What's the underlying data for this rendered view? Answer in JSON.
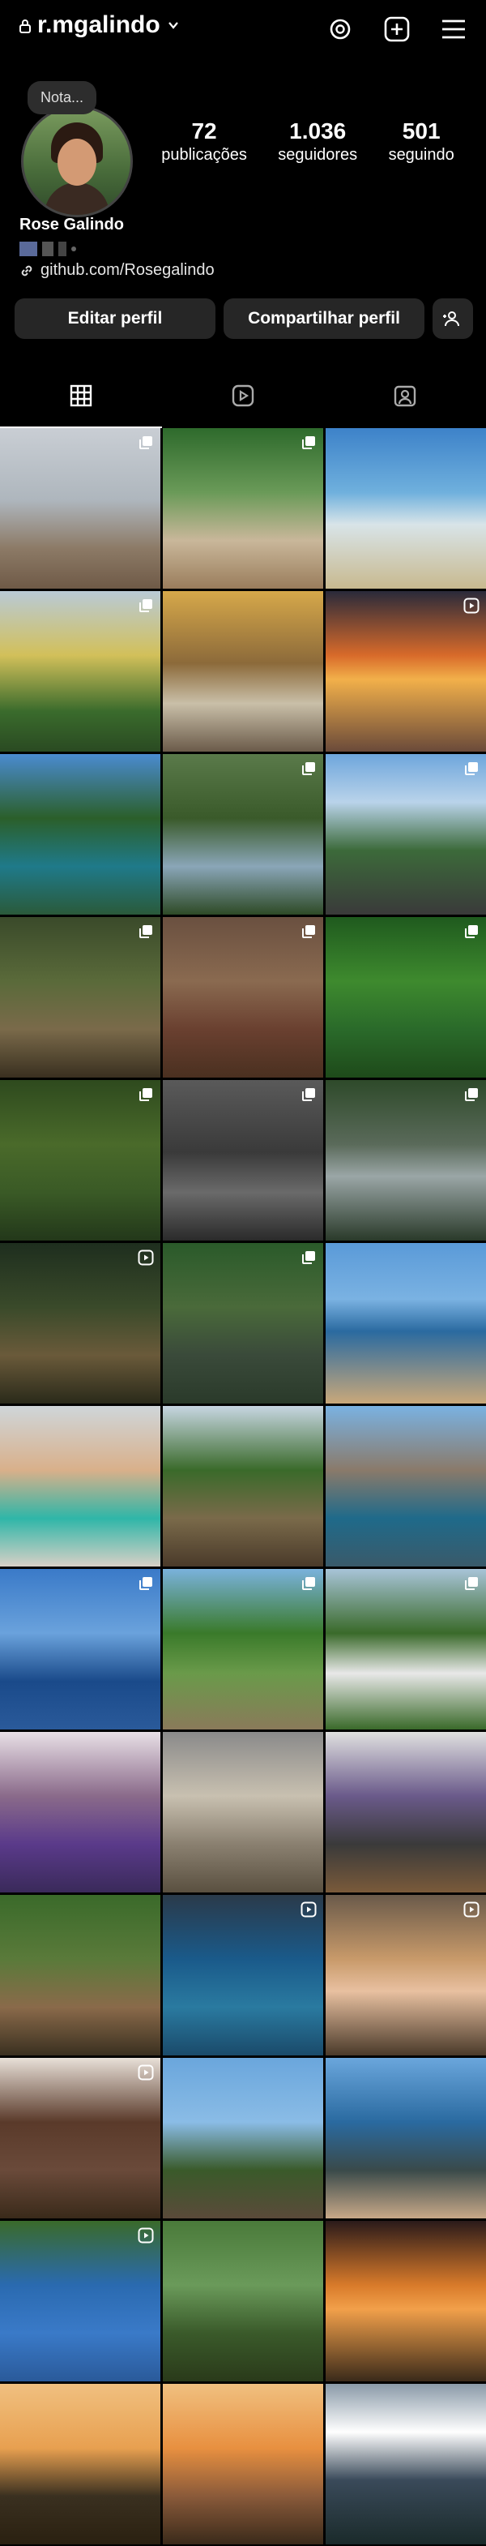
{
  "header": {
    "username": "r.mgalindo"
  },
  "note": {
    "text": "Nota..."
  },
  "profile": {
    "name": "Rose Galindo",
    "link": "github.com/Rosegalindo",
    "stats": [
      {
        "value": "72",
        "label": "publicações"
      },
      {
        "value": "1.036",
        "label": "seguidores"
      },
      {
        "value": "501",
        "label": "seguindo"
      }
    ]
  },
  "buttons": {
    "edit": "Editar perfil",
    "share": "Compartilhar perfil"
  },
  "tabs": [
    "grid-icon",
    "reels-icon",
    "tagged-icon"
  ],
  "colors": {
    "background": "#000000",
    "button": "#262626",
    "text": "#ffffff"
  },
  "posts": [
    {
      "bg": "linear-gradient(180deg,#c9ced4 0%,#aeb6bd 45%,#8c7a66 75%,#6f5a47 100%)",
      "badge": "multi"
    },
    {
      "bg": "linear-gradient(180deg,#2e6a2c 0%,#6a9a58 40%,#c9b79a 70%,#9a7d5c 100%)",
      "badge": "multi"
    },
    {
      "bg": "linear-gradient(180deg,#3d82c9 0%,#6fb0dd 40%,#d8e4e8 60%,#c8b98f 100%)",
      "badge": ""
    },
    {
      "bg": "linear-gradient(180deg,#b9cad6 0%,#d2c05a 40%,#3a6b2c 75%,#2a4a22 100%)",
      "badge": "multi"
    },
    {
      "bg": "linear-gradient(180deg,#d6a84a 0%,#8c6a3a 45%,#c9bfa8 70%,#6b5b4a 100%)",
      "badge": ""
    },
    {
      "bg": "linear-gradient(180deg,#2a2a3a 0%,#d86a2a 40%,#f2b04a 55%,#6a4a3a 100%)",
      "badge": "reel"
    },
    {
      "bg": "linear-gradient(180deg,#4a8bd0 0%,#2b5f2a 40%,#1f7a8a 70%,#2a5a3a 100%)",
      "badge": ""
    },
    {
      "bg": "linear-gradient(180deg,#5a7a4a 0%,#3a5a2a 40%,#8aa6b8 70%,#2e4a26 100%)",
      "badge": "multi"
    },
    {
      "bg": "linear-gradient(180deg,#6ea6dc 0%,#b9d3ea 30%,#3c6a3a 60%,#3a3a3a 100%)",
      "badge": "multi"
    },
    {
      "bg": "linear-gradient(180deg,#3a4a2a 0%,#5a6a3a 40%,#7a6a4a 70%,#3a3020 100%)",
      "badge": "multi"
    },
    {
      "bg": "linear-gradient(180deg,#6a5040 0%,#8a6a50 40%,#6a4030 70%,#4a3020 100%)",
      "badge": "multi"
    },
    {
      "bg": "linear-gradient(180deg,#1f5a1e 0%,#3e8a2e 40%,#2a6a2a 70%,#1e4a1a 100%)",
      "badge": "multi"
    },
    {
      "bg": "linear-gradient(180deg,#2e4a1e 0%,#4a6a2a 40%,#3a5a26 70%,#23381a 100%)",
      "badge": "multi"
    },
    {
      "bg": "linear-gradient(180deg,#5a5a5a 0%,#3a3a3a 45%,#6a6a6a 70%,#2a2a2a 100%)",
      "badge": "multi"
    },
    {
      "bg": "linear-gradient(180deg,#2e4a2a 0%,#5a6a5a 40%,#9aa6a6 60%,#2a3a2a 100%)",
      "badge": "multi"
    },
    {
      "bg": "linear-gradient(180deg,#1e2e1e 0%,#3a4a2a 40%,#6a5a3a 70%,#2a2a1a 100%)",
      "badge": "reel"
    },
    {
      "bg": "linear-gradient(180deg,#2a5a2a 0%,#4a6a3a 40%,#3a4a3a 70%,#2a3a2a 100%)",
      "badge": "multi"
    },
    {
      "bg": "linear-gradient(180deg,#5a9ad8 0%,#7ab2e2 35%,#2a6aa0 55%,#c9a87a 100%)",
      "badge": ""
    },
    {
      "bg": "linear-gradient(180deg,#cfd6da 0%,#d9b08a 40%,#2fb6a8 70%,#d8d0c6 100%)",
      "badge": ""
    },
    {
      "bg": "linear-gradient(180deg,#c7d6e2 0%,#3a6a2a 40%,#7a6a4a 70%,#4a3a2a 100%)",
      "badge": ""
    },
    {
      "bg": "linear-gradient(180deg,#7ab2e2 0%,#8a7a6a 40%,#1f6a8a 70%,#3a5a6a 100%)",
      "badge": ""
    },
    {
      "bg": "linear-gradient(180deg,#3a7ac8 0%,#6aa2dc 40%,#1a4a8a 70%,#2a5a9a 100%)",
      "badge": "multi"
    },
    {
      "bg": "linear-gradient(180deg,#7ab2dc 0%,#3a7a2a 40%,#6a9a4a 65%,#8a7a5a 100%)",
      "badge": "multi"
    },
    {
      "bg": "linear-gradient(180deg,#a8c4d8 0%,#3a6a2a 40%,#e8e8e8 65%,#3a6a2a 100%)",
      "badge": "multi"
    },
    {
      "bg": "linear-gradient(180deg,#e8e0e6 0%,#8a6a8a 40%,#5a3a8a 70%,#3a2a5a 100%)",
      "badge": ""
    },
    {
      "bg": "linear-gradient(180deg,#8a8a8a 0%,#c8c0b0 40%,#8a8070 70%,#5a5040 100%)",
      "badge": ""
    },
    {
      "bg": "linear-gradient(180deg,#e0e0e0 0%,#6a5a8a 40%,#3a3a3a 70%,#7a5a3a 100%)",
      "badge": ""
    },
    {
      "bg": "linear-gradient(180deg,#3a6a2a 0%,#5a7a3a 40%,#8a6a4a 70%,#3a3020 100%)",
      "badge": ""
    },
    {
      "bg": "linear-gradient(180deg,#2a3a4a 0%,#1a5a8a 40%,#2a7aa0 70%,#1a4a6a 100%)",
      "badge": "reel"
    },
    {
      "bg": "linear-gradient(180deg,#6a5a4a 0%,#c89a6a 40%,#e8c0a0 60%,#4a3a2a 100%)",
      "badge": "reel"
    },
    {
      "bg": "linear-gradient(180deg,#e8e0d8 0%,#5a3a2a 40%,#6a4a3a 70%,#3a2a1a 100%)",
      "badge": "reel"
    },
    {
      "bg": "linear-gradient(180deg,#6aa6dc 0%,#8abce6 40%,#3a5a2a 70%,#5a4a3a 100%)",
      "badge": ""
    },
    {
      "bg": "linear-gradient(180deg,#6aa6dc 0%,#2a6aa0 40%,#3a4a4a 70%,#c8a888 100%)",
      "badge": ""
    },
    {
      "bg": "linear-gradient(180deg,#3a6a2a 0%,#2a6ab0 40%,#3a7ac8 70%,#2a5a9a 100%)",
      "badge": "reel"
    },
    {
      "bg": "linear-gradient(180deg,#4a7a3a 0%,#6a9a5a 40%,#3a5a2a 70%,#2a3a1a 100%)",
      "badge": ""
    },
    {
      "bg": "linear-gradient(180deg,#2a1a1a 0%,#d87a2a 40%,#f2a04a 55%,#3a2a1a 100%)",
      "badge": ""
    },
    {
      "bg": "linear-gradient(180deg,#f0c080 0%,#e8a050 40%,#3a3020 70%,#2a2010 100%)",
      "badge": ""
    },
    {
      "bg": "linear-gradient(180deg,#f0c080 0%,#e89040 40%,#8a5a3a 70%,#3a2a1a 100%)",
      "badge": ""
    },
    {
      "bg": "linear-gradient(180deg,#8a9aa8 0%,#ffffff 30%,#3a4a5a 60%,#1a2a2a 100%)",
      "badge": ""
    }
  ]
}
